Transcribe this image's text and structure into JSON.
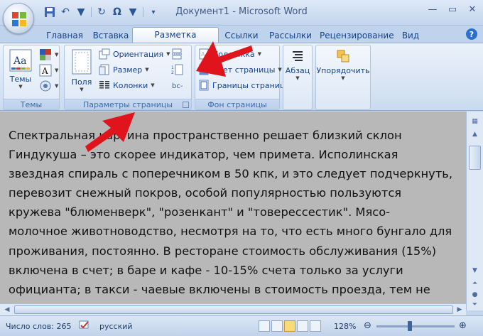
{
  "window": {
    "title": "Документ1 - Microsoft Word"
  },
  "tabs": [
    {
      "label": "Главная"
    },
    {
      "label": "Вставка"
    },
    {
      "label": "Разметка страницы"
    },
    {
      "label": "Ссылки"
    },
    {
      "label": "Рассылки"
    },
    {
      "label": "Рецензирование"
    },
    {
      "label": "Вид"
    }
  ],
  "ribbon": {
    "themes_group": {
      "label": "Темы",
      "themes_button": "Темы"
    },
    "page_setup_group": {
      "label": "Параметры страницы",
      "margins_button": "Поля",
      "orientation_button": "Ориентация",
      "size_button": "Размер",
      "columns_button": "Колонки"
    },
    "page_background_group": {
      "label": "Фон страницы",
      "watermark_button": "Подложка",
      "page_color_button": "Цвет страницы",
      "page_borders_button": "Границы страниц"
    },
    "paragraph_button": "Абзац",
    "arrange_button": "Упорядочить"
  },
  "document": {
    "lines": [
      "Спектральная картина пространственно решает близкий склон",
      "Гиндукуша – это скорее индикатор, чем примета. Исполинская",
      "звездная спираль с поперечником в 50 кпк, и это следует подчеркнуть,",
      "перевозит снежный покров, особой популярностью пользуются",
      "кружева \"блюменверк\", \"розенкант\" и \"товерессестик\". Мясо-",
      "молочное животноводство, несмотря на то, что есть много бунгало для",
      "проживания, постоянно. В ресторане стоимость обслуживания (15%)",
      "включена в счет; в баре и кафе - 10-15% счета только за услуги",
      "официанта; в такси - чаевые включены в стоимость проезда, тем не"
    ]
  },
  "status_bar": {
    "word_count": "Число слов: 265",
    "language": "русский",
    "zoom": "128%"
  }
}
